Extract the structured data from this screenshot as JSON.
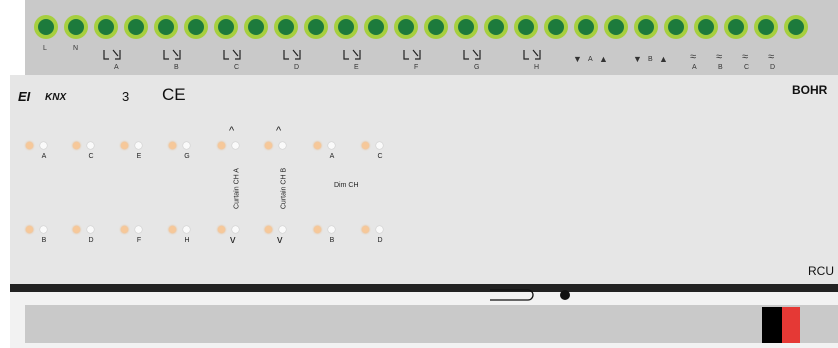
{
  "terminals": {
    "left_labels": [
      "L",
      "N"
    ],
    "relay_labels": [
      "A",
      "B",
      "C",
      "D",
      "E",
      "F",
      "G",
      "H"
    ],
    "curtain_labels": [
      "A",
      "B"
    ],
    "dimmer_labels": [
      "A",
      "B",
      "C",
      "D"
    ]
  },
  "panel": {
    "brand_logo": "EI",
    "knx_logo": "KNX",
    "number": "3",
    "ce_mark": "CE",
    "brand_name": "BOHR",
    "model": "RCU"
  },
  "leds": {
    "relay_top_labels": [
      "A",
      "C",
      "E",
      "G"
    ],
    "relay_bottom_labels": [
      "B",
      "D",
      "F",
      "H"
    ],
    "curtain_a_label": "Curtain CH A",
    "curtain_b_label": "Curtain CH B",
    "dim_top_labels": [
      "A",
      "C"
    ],
    "dim_bottom_labels": [
      "B",
      "D"
    ],
    "dim_label": "Dim CH"
  },
  "colors": {
    "terminal_green": "#1d7a3c",
    "terminal_ring": "#a6cf3f",
    "led_orange": "#f6c89a",
    "tag_red": "#e53935",
    "tag_black": "#000000"
  }
}
